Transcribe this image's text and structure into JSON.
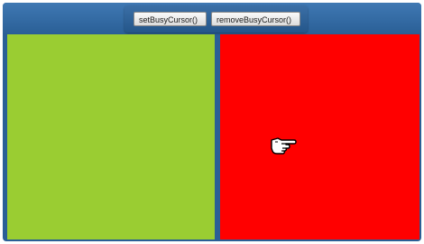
{
  "toolbar": {
    "set_busy_label": "setBusyCursor()",
    "remove_busy_label": "removeBusyCursor()"
  },
  "panels": {
    "left": {
      "color": "#9acd32"
    },
    "right": {
      "color": "#ff0000"
    }
  },
  "cursor": {
    "icon": "pointing-hand-icon"
  }
}
